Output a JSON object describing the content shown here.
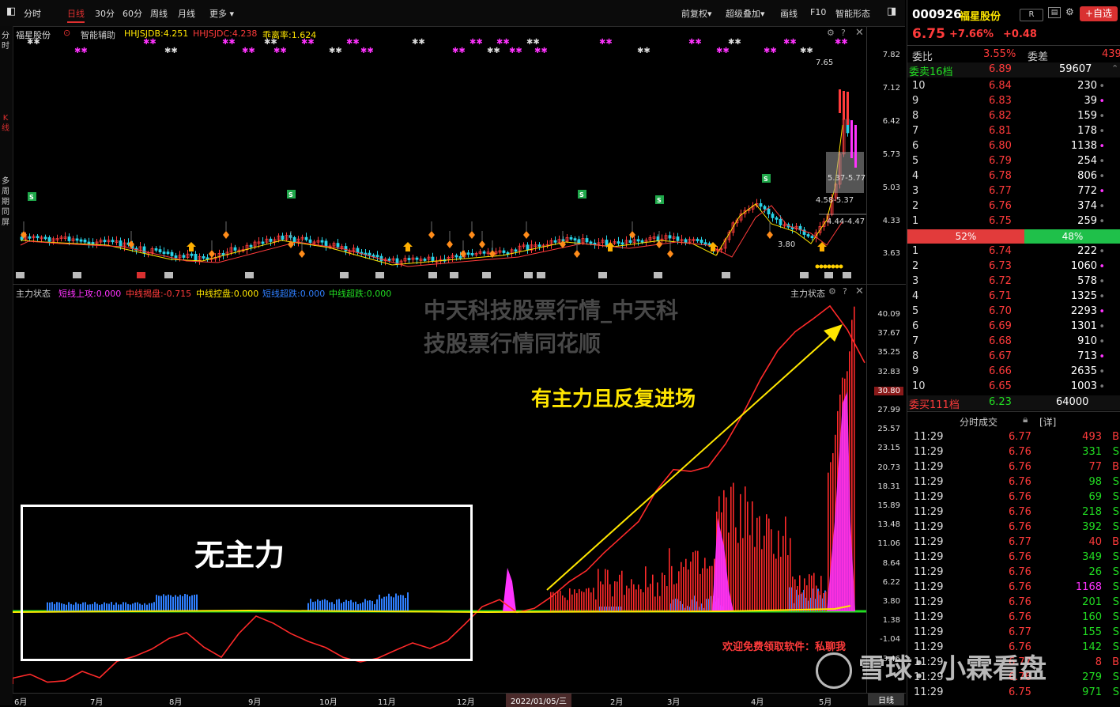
{
  "toolbar": {
    "tabs": [
      "分时",
      "日线",
      "30分",
      "60分",
      "周线",
      "月线",
      "更多"
    ],
    "right": [
      "前复权",
      "超级叠加",
      "画线",
      "F10",
      "智能形态"
    ]
  },
  "left_strip": [
    "分时",
    "K线",
    "多周期同屏"
  ],
  "kline_header": {
    "name": "福星股份",
    "assist": "智能辅助",
    "hhjsjdb": "HHJSJDB:4.251",
    "hhjsjdc": "HHJSJDC:4.238",
    "deviation": "乖离率:1.624"
  },
  "k_axis": [
    "7.82",
    "7.12",
    "6.42",
    "5.73",
    "5.03",
    "4.33",
    "3.63"
  ],
  "k_annotations": {
    "high": "7.65",
    "low": "3.80",
    "a": "5.37-5.77",
    "b": "4.58-5.37",
    "c": "4.44-4.47"
  },
  "ind_header": {
    "title": "主力状态",
    "items": [
      "短线上攻:0.000",
      "中线揭盘:-0.715",
      "中线控盘:0.000",
      "短线超跌:0.000",
      "中线超跌:0.000"
    ],
    "right_title": "主力状态"
  },
  "i_axis": [
    "40.09",
    "37.67",
    "35.25",
    "32.83",
    "30.80",
    "27.99",
    "25.57",
    "23.15",
    "20.73",
    "18.31",
    "15.89",
    "13.48",
    "11.06",
    "8.64",
    "6.22",
    "3.80",
    "1.38",
    "-1.04",
    "-3.46"
  ],
  "overlay": {
    "watermark": "中天科技股票行情_中天科技股票行情同花顺",
    "no_main": "无主力",
    "main_in": "有主力且反复进场",
    "promo": "欢迎免费领取软件：私聊我",
    "xueqiu": "雪球：小霖看盘"
  },
  "date_axis": [
    "6月",
    "7月",
    "8月",
    "9月",
    "10月",
    "11月",
    "12月",
    "2022/01/05/三",
    "2月",
    "3月",
    "4月",
    "5月",
    "日线"
  ],
  "quote": {
    "code": "000926",
    "name": "福星股份",
    "r_badge": "R",
    "add": "+自选",
    "price": "6.75",
    "pct": "+7.66%",
    "chg": "+0.48",
    "webi_label": "委比",
    "webi": "3.55%",
    "wecha_label": "委差",
    "wecha": "439",
    "sell_total_label": "委卖16档",
    "sell_total_price": "6.89",
    "sell_total_vol": "59607",
    "buy_ratio": "52%",
    "sell_ratio": "48%",
    "buy_total_label": "委买111档",
    "buy_total_price": "6.23",
    "buy_total_vol": "64000",
    "trades_title": "分时成交",
    "trades_detail": "[详]"
  },
  "asks": [
    {
      "lvl": "10",
      "price": "6.84",
      "vol": "230"
    },
    {
      "lvl": "9",
      "price": "6.83",
      "vol": "39"
    },
    {
      "lvl": "8",
      "price": "6.82",
      "vol": "159"
    },
    {
      "lvl": "7",
      "price": "6.81",
      "vol": "178"
    },
    {
      "lvl": "6",
      "price": "6.80",
      "vol": "1138"
    },
    {
      "lvl": "5",
      "price": "6.79",
      "vol": "254"
    },
    {
      "lvl": "4",
      "price": "6.78",
      "vol": "806"
    },
    {
      "lvl": "3",
      "price": "6.77",
      "vol": "772"
    },
    {
      "lvl": "2",
      "price": "6.76",
      "vol": "374"
    },
    {
      "lvl": "1",
      "price": "6.75",
      "vol": "259"
    }
  ],
  "bids": [
    {
      "lvl": "1",
      "price": "6.74",
      "vol": "222"
    },
    {
      "lvl": "2",
      "price": "6.73",
      "vol": "1060"
    },
    {
      "lvl": "3",
      "price": "6.72",
      "vol": "578"
    },
    {
      "lvl": "4",
      "price": "6.71",
      "vol": "1325"
    },
    {
      "lvl": "5",
      "price": "6.70",
      "vol": "2293"
    },
    {
      "lvl": "6",
      "price": "6.69",
      "vol": "1301"
    },
    {
      "lvl": "7",
      "price": "6.68",
      "vol": "910"
    },
    {
      "lvl": "8",
      "price": "6.67",
      "vol": "713"
    },
    {
      "lvl": "9",
      "price": "6.66",
      "vol": "2635"
    },
    {
      "lvl": "10",
      "price": "6.65",
      "vol": "1003"
    }
  ],
  "trades": [
    {
      "t": "11:29",
      "p": "6.77",
      "v": "493",
      "d": "B"
    },
    {
      "t": "11:29",
      "p": "6.76",
      "v": "331",
      "d": "S"
    },
    {
      "t": "11:29",
      "p": "6.76",
      "v": "77",
      "d": "B"
    },
    {
      "t": "11:29",
      "p": "6.76",
      "v": "98",
      "d": "S"
    },
    {
      "t": "11:29",
      "p": "6.76",
      "v": "69",
      "d": "S"
    },
    {
      "t": "11:29",
      "p": "6.76",
      "v": "218",
      "d": "S"
    },
    {
      "t": "11:29",
      "p": "6.76",
      "v": "392",
      "d": "S"
    },
    {
      "t": "11:29",
      "p": "6.77",
      "v": "40",
      "d": "B"
    },
    {
      "t": "11:29",
      "p": "6.76",
      "v": "349",
      "d": "S"
    },
    {
      "t": "11:29",
      "p": "6.76",
      "v": "26",
      "d": "S"
    },
    {
      "t": "11:29",
      "p": "6.76",
      "v": "1168",
      "d": "S"
    },
    {
      "t": "11:29",
      "p": "6.76",
      "v": "201",
      "d": "S"
    },
    {
      "t": "11:29",
      "p": "6.76",
      "v": "160",
      "d": "S"
    },
    {
      "t": "11:29",
      "p": "6.77",
      "v": "155",
      "d": "S"
    },
    {
      "t": "11:29",
      "p": "6.76",
      "v": "142",
      "d": "S"
    },
    {
      "t": "11:29",
      "p": "6.77",
      "v": "8",
      "d": "B"
    },
    {
      "t": "11:29",
      "p": "6.76",
      "v": "279",
      "d": "S"
    },
    {
      "t": "11:29",
      "p": "6.75",
      "v": "971",
      "d": "S"
    }
  ],
  "colors": {
    "up": "#ff3b3b",
    "down": "#29d3e8",
    "accent": "#e03030",
    "yellow": "#ffe600",
    "magenta": "#ff33ff",
    "blue": "#2f7fff",
    "green": "#22dd22"
  }
}
